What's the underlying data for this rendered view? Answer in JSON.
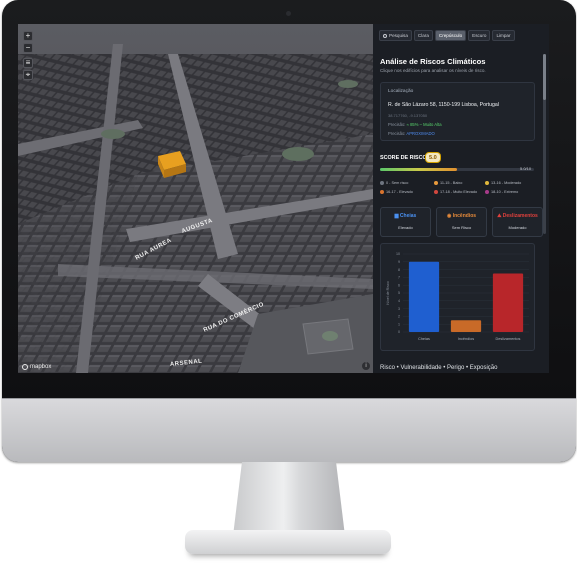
{
  "map": {
    "zoom_in": "+",
    "zoom_out": "−",
    "layers_icon": "layers-icon",
    "compass_icon": "compass-icon",
    "logo_text": "mapbox",
    "attribution": "i",
    "streets": [
      "AUGUSTA",
      "RUA DO COMÉRCIO",
      "RUA AUREA",
      "ARSENAL"
    ],
    "highlight_color": "#e8a020"
  },
  "panel": {
    "tabs": [
      {
        "label": "Pesquisa",
        "active": false
      },
      {
        "label": "Clara",
        "active": false
      },
      {
        "label": "Crepúsculo",
        "active": true
      },
      {
        "label": "Escuro",
        "active": false
      },
      {
        "label": "Limpar",
        "active": false
      }
    ],
    "title": "Análise de Riscos Climáticos",
    "subtitle": "Clique nos edifícios para analisar os níveis de risco.",
    "location": {
      "heading": "Localização",
      "address": "R. de São Lázaro 58, 1150-199 Lisboa, Portugal",
      "coords": "38.717760, -9.137050",
      "row1_label": "Precisão:",
      "row1_value": "≈ 85% – Muito Alta",
      "row2_label": "Precisão:",
      "row2_value": "APROXIMADO"
    },
    "score": {
      "label": "SCORE DE RISCO:",
      "value": "5.0",
      "fraction": 0.5,
      "max": "5.0/10"
    },
    "legend": [
      {
        "text": "0 - Sem risco",
        "color": "#6e7580"
      },
      {
        "text": "11-15 - Baixo",
        "color": "#e89a3c"
      },
      {
        "text": "13-16 - Moderado",
        "color": "#e0b83c"
      },
      {
        "text": "16-17 - Elevado",
        "color": "#d9742e"
      },
      {
        "text": "17-18 - Muito Elevado",
        "color": "#d2473e"
      },
      {
        "text": "18-10 - Extremo",
        "color": "#a83a8a"
      }
    ],
    "cards": [
      {
        "title": "Cheias",
        "status": "Elevado",
        "color": "#4a90f0"
      },
      {
        "title": "Incêndios",
        "status": "Sem Risco",
        "color": "#e58a3a"
      },
      {
        "title": "Deslizamentos",
        "status": "Moderado",
        "color": "#e0403c"
      }
    ],
    "bottom_text": "Risco • Vulnerabilidade • Perigo • Exposição"
  },
  "chart_data": {
    "type": "bar",
    "categories": [
      "Cheias",
      "Incêndios",
      "Deslizamentos"
    ],
    "values": [
      9,
      1.5,
      7.5
    ],
    "colors": [
      "#1f5fd0",
      "#c96a28",
      "#b8262a"
    ],
    "ylabel": "Nível de Risco",
    "ylim": [
      0,
      10
    ],
    "yticks": [
      "10",
      "9",
      "8",
      "7",
      "6",
      "5",
      "4",
      "3",
      "2",
      "1",
      "0"
    ],
    "grid": true
  }
}
